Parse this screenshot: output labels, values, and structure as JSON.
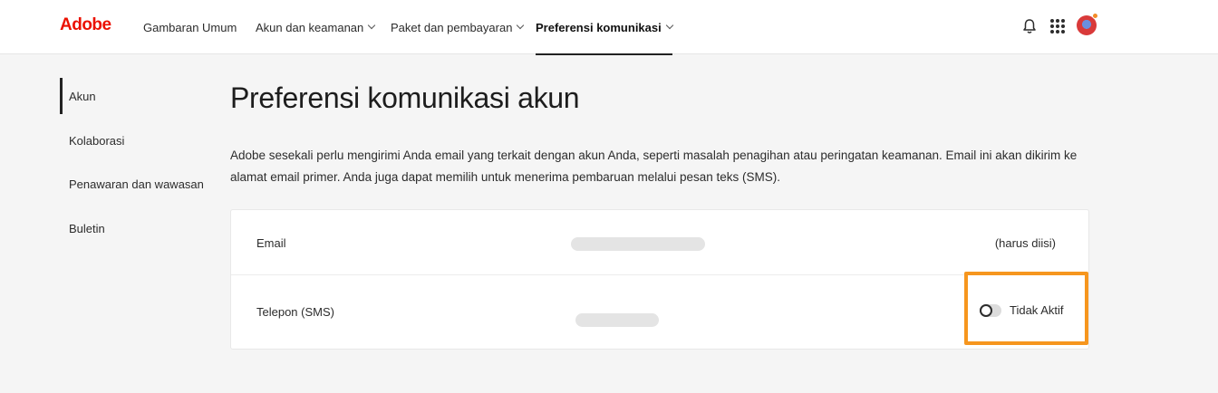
{
  "header": {
    "logo": "Adobe",
    "nav": [
      {
        "label": "Gambaran Umum"
      },
      {
        "label": "Akun dan keamanan"
      },
      {
        "label": "Paket dan pembayaran"
      },
      {
        "label": "Preferensi komunikasi"
      }
    ],
    "icons": [
      "bell-icon",
      "apps-grid-icon",
      "avatar"
    ]
  },
  "sidebar": {
    "items": [
      {
        "label": "Akun",
        "active": true
      },
      {
        "label": "Kolaborasi"
      },
      {
        "label": "Penawaran dan wawasan"
      },
      {
        "label": "Buletin"
      }
    ]
  },
  "main": {
    "title": "Preferensi komunikasi akun",
    "description": "Adobe sesekali perlu mengirimi Anda email yang terkait dengan akun Anda, seperti masalah penagihan atau peringatan keamanan. Email ini akan dikirim ke alamat email primer. Anda juga dapat memilih untuk menerima pembaruan melalui pesan teks (SMS).",
    "rows": [
      {
        "label": "Email",
        "status": "(harus diisi)"
      },
      {
        "label": "Telepon (SMS)",
        "toggle_label": "Tidak Aktif",
        "toggle_on": false
      }
    ]
  },
  "colors": {
    "brand": "#eb1000",
    "highlight": "#f6961e"
  }
}
